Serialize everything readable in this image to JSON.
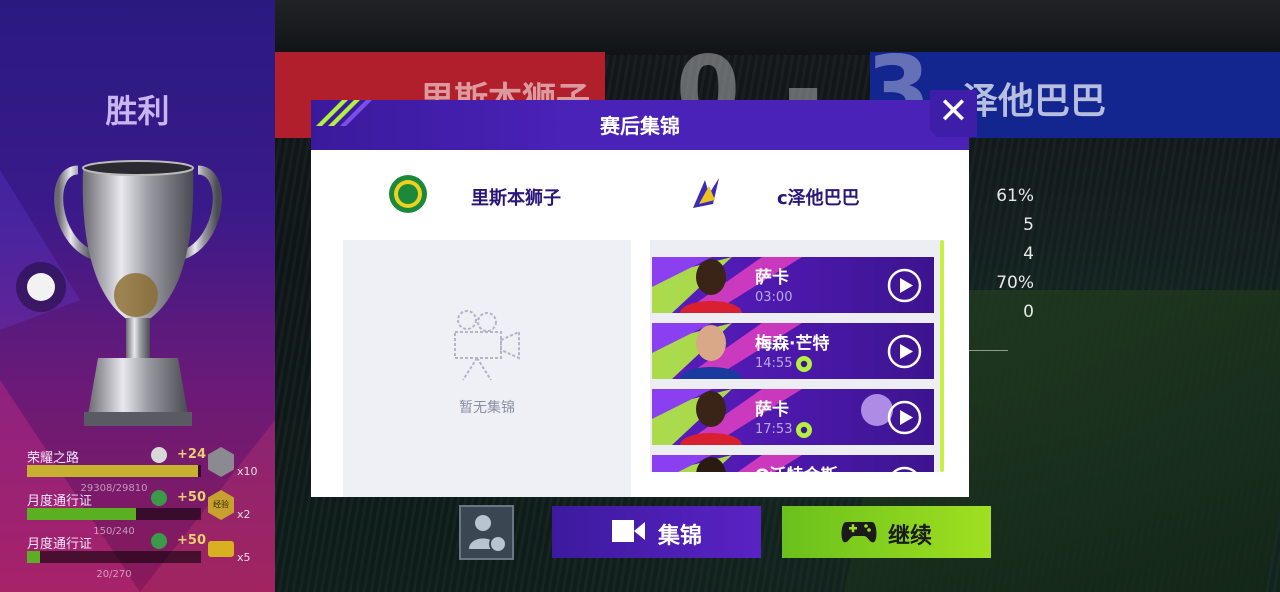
{
  "result": {
    "title": "胜利"
  },
  "scoreboard": {
    "home_team": "里斯本狮子",
    "away_team": "泽他巴巴",
    "score": "0 - 3"
  },
  "stats": [
    "61%",
    "5",
    "4",
    "70%",
    "0"
  ],
  "progress": [
    {
      "label": "荣耀之路",
      "plus": "+24",
      "value": "29308/29810",
      "fraction": 0.98,
      "fill": "#c8b030",
      "mult": "x10"
    },
    {
      "label": "月度通行证",
      "plus": "+50",
      "value": "150/240",
      "fraction": 0.625,
      "fill": "#5ab020",
      "mult": "x2"
    },
    {
      "label": "月度通行证",
      "plus": "+50",
      "value": "20/270",
      "fraction": 0.074,
      "fill": "#5ab020",
      "mult": "x5"
    }
  ],
  "reward_badge_text": "经验",
  "modal": {
    "title": "赛后集锦",
    "home_team": "里斯本狮子",
    "away_team": "c泽他巴巴",
    "empty_text": "暂无集锦",
    "close": "✕"
  },
  "clips": [
    {
      "player": "萨卡",
      "time": "03:00",
      "goal": false
    },
    {
      "player": "梅森·芒特",
      "time": "14:55",
      "goal": true
    },
    {
      "player": "萨卡",
      "time": "17:53",
      "goal": true
    },
    {
      "player": "Q沃特金斯",
      "time": "",
      "goal": false
    }
  ],
  "buttons": {
    "highlights": "集锦",
    "continue": "继续"
  },
  "colors": {
    "accent_purple": "#4a22b8",
    "accent_green": "#a0e020",
    "score_red": "#b21f2c",
    "score_blue": "#13258f"
  }
}
